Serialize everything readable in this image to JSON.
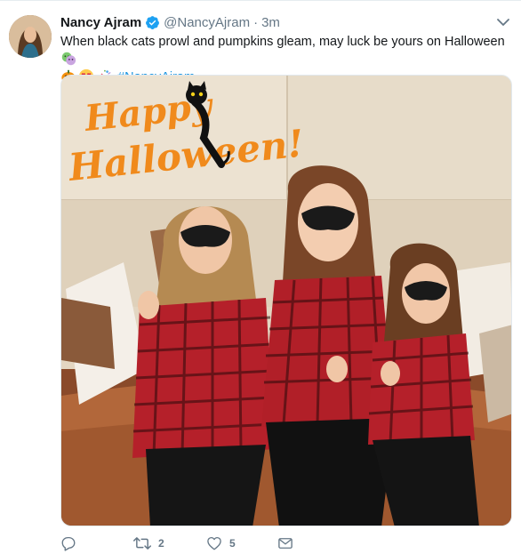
{
  "tweet": {
    "display_name": "Nancy Ajram",
    "handle": "@NancyAjram",
    "separator": "·",
    "timestamp": "3m",
    "text_main": "When black cats prowl and pumpkins gleam, may luck be yours on Halloween",
    "hashtag": "#NancyAjram",
    "emojis": [
      "pumpkin-emoji",
      "heart-eyes-emoji",
      "party-popper-emoji",
      "masks-emoji"
    ]
  },
  "image": {
    "overlay_line1": "Happy",
    "overlay_line2": "Halloween!",
    "overlay_color": "#f08a1c"
  },
  "actions": {
    "reply_count": "",
    "retweet_count": "2",
    "like_count": "5"
  },
  "colors": {
    "link": "#1b95e0",
    "muted": "#657786",
    "verified": "#1da1f2"
  }
}
